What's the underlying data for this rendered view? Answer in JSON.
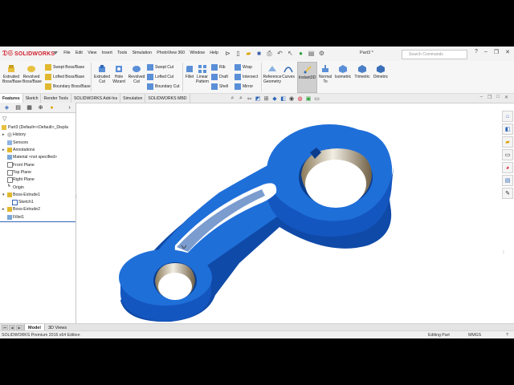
{
  "app": {
    "brand": "SOLIDWORKS",
    "menus": [
      "File",
      "Edit",
      "View",
      "Insert",
      "Tools",
      "Simulation",
      "PhotoView 360",
      "Window",
      "Help"
    ],
    "document_title": "Part3 *",
    "search_placeholder": "Search Commands"
  },
  "ribbon": {
    "extruded_boss": "Extruded Boss/Base",
    "revolved_boss": "Revolved Boss/Base",
    "swept_boss": "Swept Boss/Base",
    "lofted_boss": "Lofted Boss/Base",
    "boundary_boss": "Boundary Boss/Base",
    "extruded_cut": "Extruded Cut",
    "hole_wizard": "Hole Wizard",
    "revolved_cut": "Revolved Cut",
    "swept_cut": "Swept Cut",
    "lofted_cut": "Lofted Cut",
    "boundary_cut": "Boundary Cut",
    "fillet": "Fillet",
    "linear_pattern": "Linear Pattern",
    "rib": "Rib",
    "draft": "Draft",
    "shell": "Shell",
    "wrap": "Wrap",
    "intersect": "Intersect",
    "mirror": "Mirror",
    "reference_geometry": "Reference Geometry",
    "curves": "Curves",
    "instant3d": "Instant3D",
    "normal_to": "Normal To",
    "isometric": "Isometric",
    "trimetric": "Trimetric",
    "dimetric": "Dimetric"
  },
  "tabs": [
    "Features",
    "Sketch",
    "Render Tools",
    "SOLIDWORKS Add-Ins",
    "Simulation",
    "SOLIDWORKS MBD"
  ],
  "tree": {
    "root": "Part3  (Default<<Default>_Displa",
    "items": [
      {
        "label": "History",
        "icon": "history-icon",
        "twisty": "▸"
      },
      {
        "label": "Sensors",
        "icon": "sensor-icon",
        "twisty": ""
      },
      {
        "label": "Annotations",
        "icon": "annotation-icon",
        "twisty": "▸"
      },
      {
        "label": "Material <not specified>",
        "icon": "material-icon",
        "twisty": ""
      },
      {
        "label": "Front Plane",
        "icon": "plane-icon",
        "twisty": ""
      },
      {
        "label": "Top Plane",
        "icon": "plane-icon",
        "twisty": ""
      },
      {
        "label": "Right Plane",
        "icon": "plane-icon",
        "twisty": ""
      },
      {
        "label": "Origin",
        "icon": "origin-icon",
        "twisty": ""
      },
      {
        "label": "Boss-Extrude1",
        "icon": "extrude-icon",
        "twisty": "▾"
      },
      {
        "label": "Sketch1",
        "icon": "sketch-icon",
        "twisty": ""
      },
      {
        "label": "Boss-Extrude2",
        "icon": "extrude-icon",
        "twisty": "▸"
      },
      {
        "label": "Fillet1",
        "icon": "fillet-icon",
        "twisty": ""
      }
    ]
  },
  "bottom_tabs": [
    "Model",
    "3D Views"
  ],
  "status": {
    "edition": "SOLIDWORKS Premium 2016 x64 Edition",
    "mode": "Editing Part",
    "units": "MMGS"
  },
  "colors": {
    "part_blue": "#1f6fd9",
    "part_blue_dark": "#0f4aa8",
    "brand_red": "#d2202f"
  }
}
